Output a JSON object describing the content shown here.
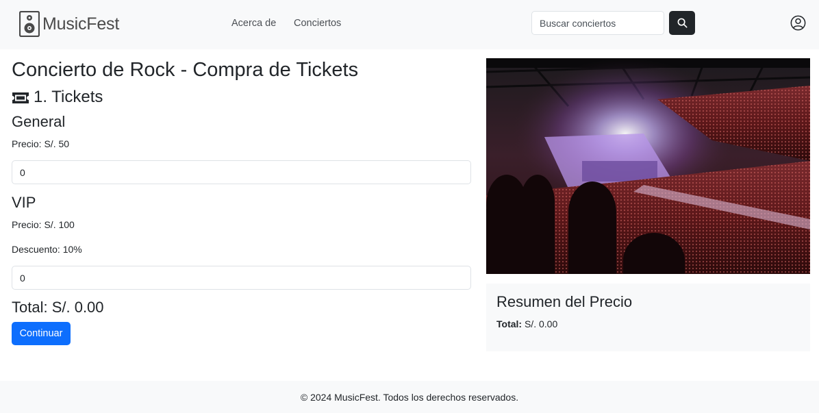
{
  "nav": {
    "brand": "MusicFest",
    "links": [
      "Acerca de",
      "Conciertos"
    ],
    "search_placeholder": "Buscar conciertos",
    "search_icon": "search-icon",
    "user_icon": "user-circle-icon"
  },
  "page": {
    "title": "Concierto de Rock - Compra de Tickets",
    "section_title": "1. Tickets",
    "section_icon": "ticket-icon"
  },
  "tickets": [
    {
      "name": "General",
      "price": "Precio: S/. 50",
      "quantity": "0"
    },
    {
      "name": "VIP",
      "price": "Precio: S/. 100",
      "discount": "Descuento: 10%",
      "quantity": "0"
    }
  ],
  "total": "Total: S/. 0.00",
  "continue_label": "Continuar",
  "summary": {
    "title": "Resumen del Precio",
    "total_label": "Total:",
    "total_value": "S/. 0.00"
  },
  "footer": "© 2024 MusicFest. Todos los derechos reservados.",
  "colors": {
    "navbar_bg": "#f8f9fa",
    "primary": "#0d6efd",
    "dark_button": "#212529",
    "text": "#212529"
  }
}
